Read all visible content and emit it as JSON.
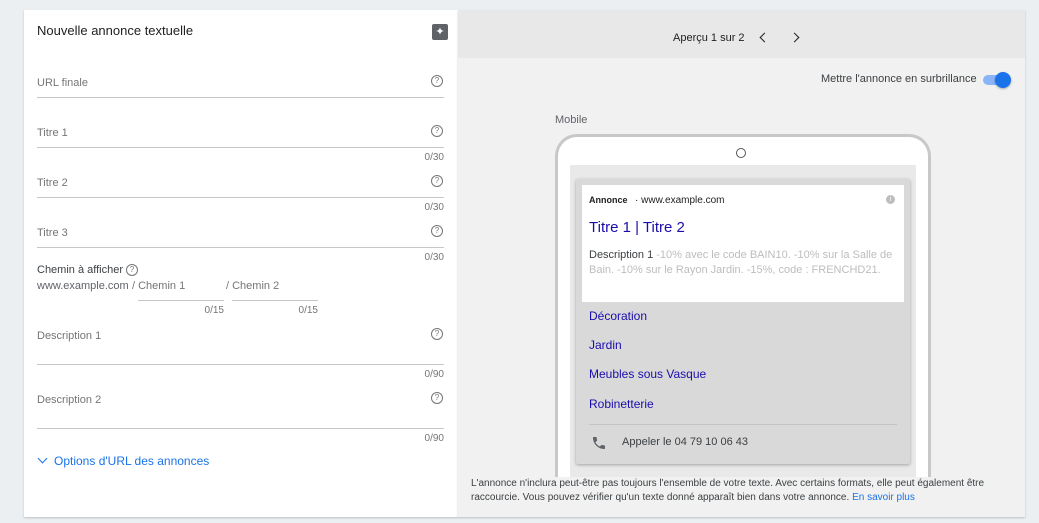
{
  "form": {
    "title": "Nouvelle annonce textuelle",
    "final_url_label": "URL finale",
    "headline1_label": "Titre 1",
    "headline1_counter": "0/30",
    "headline2_label": "Titre 2",
    "headline2_counter": "0/30",
    "headline3_label": "Titre 3",
    "headline3_counter": "0/30",
    "display_path_label": "Chemin à afficher",
    "display_domain": "www.example.com",
    "path1_label": "/ Chemin 1",
    "path1_counter": "0/15",
    "path2_label": "/ Chemin 2",
    "path2_counter": "0/15",
    "description1_label": "Description 1",
    "description1_counter": "0/90",
    "description2_label": "Description 2",
    "description2_counter": "0/90",
    "url_options_label": "Options d'URL des annonces"
  },
  "preview": {
    "pager_label": "Aperçu 1 sur 2",
    "highlight_label": "Mettre l'annonce en surbrillance",
    "highlight_enabled": true,
    "device_label": "Mobile",
    "ad": {
      "badge": "Annonce",
      "separator": "·",
      "url": "www.example.com",
      "headline": "Titre 1 | Titre 2",
      "description_lead": "Description 1",
      "description_rest": " -10% avec le code BAIN10. -10% sur la Salle de Bain. -10% sur le Rayon Jardin. -15%, code : FRENCHD21.",
      "sitelinks": [
        "Décoration",
        "Jardin",
        "Meubles sous Vasque",
        "Robinetterie"
      ],
      "call_text": "Appeler le 04 79 10 06 43"
    },
    "footnote": "L'annonce n'inclura peut-être pas toujours l'ensemble de votre texte. Avec certains formats, elle peut également être raccourcie. Vous pouvez vérifier qu'un texte donné apparaît bien dans votre annonce.",
    "learn_more": "En savoir plus"
  },
  "colors": {
    "accent": "#1a73e8",
    "ad_link": "#1a0dab",
    "panel_gray": "#f1f1f1"
  }
}
